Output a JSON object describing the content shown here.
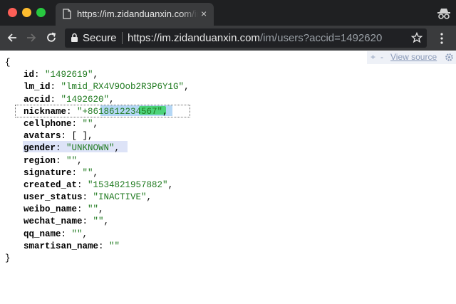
{
  "browser": {
    "tab": {
      "title": "https://im.zidanduanxin.com/im"
    },
    "omnibox": {
      "secure_label": "Secure",
      "url_host": "https://im.zidanduanxin.com",
      "url_path": "/im/users?accid=1492620"
    }
  },
  "json_viewer": {
    "plus": "+",
    "minus": "-",
    "view_source": "View source",
    "open_brace": "{",
    "close_brace": "}",
    "fields": [
      {
        "key": "id",
        "value": "\"1492619\""
      },
      {
        "key": "lm_id",
        "value": "\"lmid_RX4V9Oob2R3P6Y1G\""
      },
      {
        "key": "accid",
        "value": "\"1492620\""
      },
      {
        "key": "nickname",
        "value": "\"+8618612234567\""
      },
      {
        "key": "cellphone",
        "value": "\"\""
      },
      {
        "key": "avatars",
        "value": "[ ]"
      },
      {
        "key": "gender",
        "value": "\"UNKNOWN\""
      },
      {
        "key": "region",
        "value": "\"\""
      },
      {
        "key": "signature",
        "value": "\"\""
      },
      {
        "key": "created_at",
        "value": "\"1534821957882\""
      },
      {
        "key": "user_status",
        "value": "\"INACTIVE\""
      },
      {
        "key": "weibo_name",
        "value": "\"\""
      },
      {
        "key": "wechat_name",
        "value": "\"\""
      },
      {
        "key": "qq_name",
        "value": "\"\""
      },
      {
        "key": "smartisan_name",
        "value": "\"\""
      }
    ]
  },
  "colors": {
    "titlebar": "#1f2022",
    "toolbar": "#3a3b3d",
    "string_value": "#1f7a1f",
    "selection": "#b4d7f5"
  }
}
